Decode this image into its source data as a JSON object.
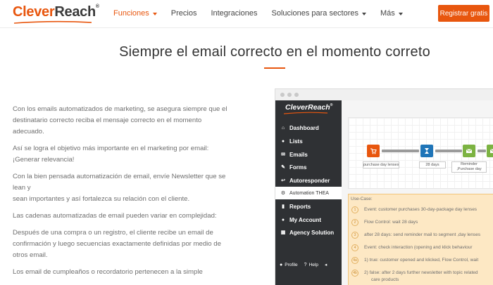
{
  "header": {
    "brand_part1": "Clever",
    "brand_part2": "Reach",
    "brand_mark": "®",
    "nav": [
      {
        "label": "Funciones",
        "dropdown": true,
        "active": true
      },
      {
        "label": "Precios",
        "dropdown": false,
        "active": false
      },
      {
        "label": "Integraciones",
        "dropdown": false,
        "active": false
      },
      {
        "label": "Soluciones para sectores",
        "dropdown": true,
        "active": false
      },
      {
        "label": "Más",
        "dropdown": true,
        "active": false
      }
    ],
    "cta_label": "Registrar gratis"
  },
  "hero": {
    "title": "Siempre el email correcto en el momento correto"
  },
  "body": {
    "paragraphs": [
      "Con los emails automatizados de marketing, se asegura siempre que el destinatario correcto reciba el mensaje correcto en el momento adecuado.",
      "Así se logra el objetivo más importante en el marketing por email: ¡Generar relevancia!",
      "Con la bien pensada automatización de email, envíe Newsletter que se lean y",
      "sean importantes y así  fortalezca su relación con el cliente.",
      "Las cadenas automatizadas de email pueden variar en complejidad:",
      "Después de una compra o un registro, el cliente recibe un email de confirmación y luego secuencias exactamente definidas por medio de otros email.",
      "Los email de cumpleaños o recordatorio pertenecen a la simple"
    ]
  },
  "mock": {
    "sidebar_brand": "CleverReach",
    "menu": [
      {
        "label": "Dashboard",
        "icon": "home-icon",
        "glyph": "⌂"
      },
      {
        "label": "Lists",
        "icon": "users-icon",
        "glyph": "●"
      },
      {
        "label": "Emails",
        "icon": "envelope-icon",
        "glyph": "✉"
      },
      {
        "label": "Forms",
        "icon": "pencil-icon",
        "glyph": "✎"
      },
      {
        "label": "Autoresponder",
        "icon": "reply-icon",
        "glyph": "↩"
      },
      {
        "label": "Automation THEA",
        "icon": "automation-icon",
        "glyph": "⚙",
        "active": true
      },
      {
        "label": "Reports",
        "icon": "bar-chart-icon",
        "glyph": "▮"
      },
      {
        "label": "My Account",
        "icon": "user-icon",
        "glyph": "●"
      },
      {
        "label": "Agency Solution",
        "icon": "building-icon",
        "glyph": "▦"
      }
    ],
    "footer": {
      "profile": "Profile",
      "help": "Help",
      "collapse_glyph": "◂"
    },
    "flow": [
      {
        "label": "purchase day lenses",
        "color": "#e8560e",
        "icon": "cart-icon",
        "glyph": "🛒"
      },
      {
        "label": "28 days",
        "color": "#1f75b8",
        "icon": "hourglass-icon",
        "glyph": "⧗"
      },
      {
        "label": "Reminder ,Purchase day lenses",
        "color": "#7cb342",
        "icon": "email-send-icon",
        "glyph": "✉"
      },
      {
        "label": "",
        "color": "#7cb342",
        "icon": "email-send-icon",
        "glyph": "✉"
      }
    ],
    "usecase": {
      "title": "Use-Case:",
      "steps": [
        {
          "num": "1",
          "text": "Event: customer purchases 30-day-package day lenses"
        },
        {
          "num": "2",
          "text": "Flow Control: wait 28 days"
        },
        {
          "num": "3",
          "text": "after 28 days: send reminder mail to segment ,day lenses"
        },
        {
          "num": "4",
          "text": "Event: check interaction (opening and klick behaviour"
        },
        {
          "num": "4a",
          "text": "1) true: customer opened and klicked, Flow Control, wait"
        },
        {
          "num": "4b",
          "text": "2) false: after 2 days further newsletter with topic related",
          "cont": "care products"
        }
      ]
    }
  }
}
